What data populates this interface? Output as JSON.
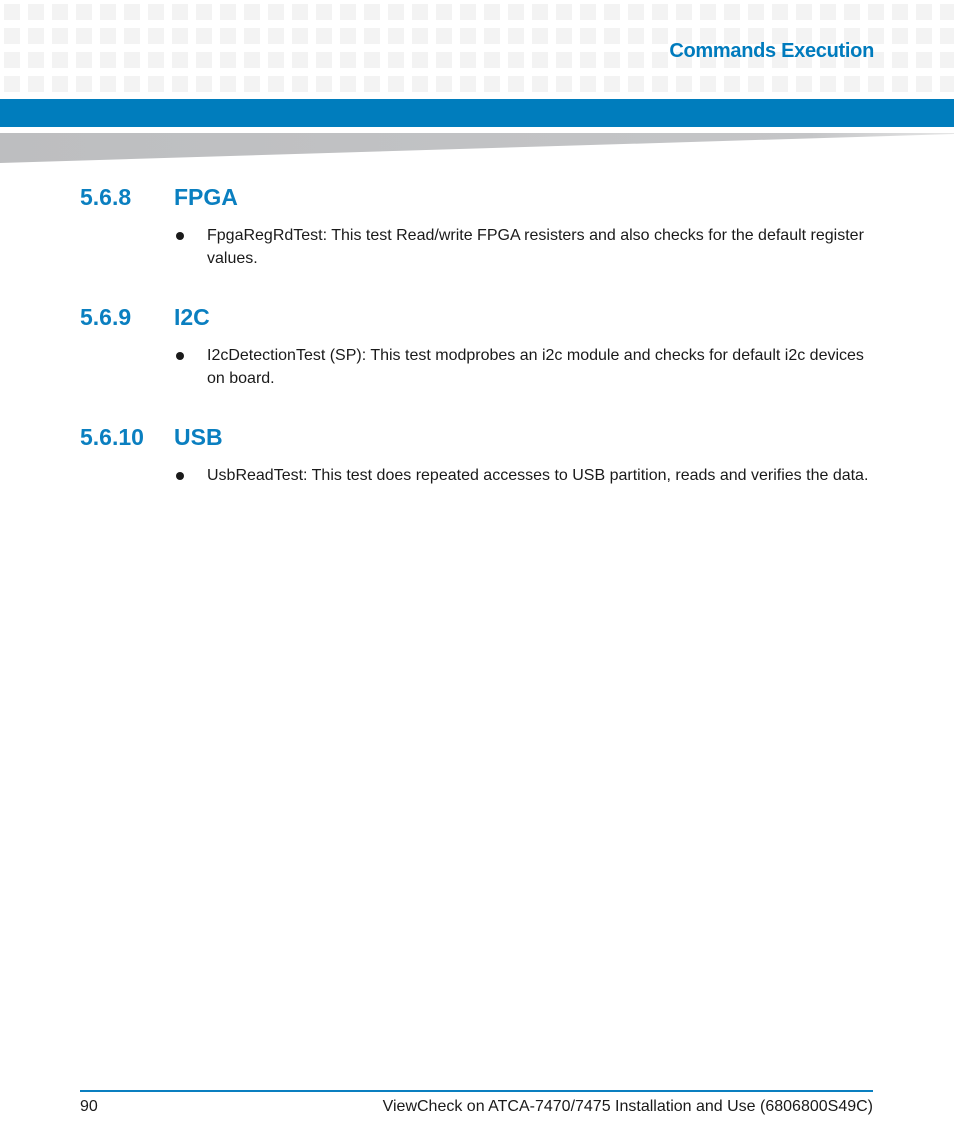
{
  "header": {
    "chapter_title": "Commands Execution",
    "accent_color": "#007dbd"
  },
  "sections": [
    {
      "number": "5.6.8",
      "title": "FPGA",
      "bullets": [
        "FpgaRegRdTest: This test Read/write FPGA resisters and also checks for the default register values."
      ]
    },
    {
      "number": "5.6.9",
      "title": "I2C",
      "bullets": [
        "I2cDetectionTest (SP): This test modprobes an i2c module and checks for default i2c devices on board."
      ]
    },
    {
      "number": "5.6.10",
      "title": "USB",
      "bullets": [
        "UsbReadTest: This test does repeated accesses to USB partition, reads and verifies the data."
      ]
    }
  ],
  "footer": {
    "page_number": "90",
    "document_title": "ViewCheck on ATCA-7470/7475 Installation and Use (6806800S49C)"
  }
}
